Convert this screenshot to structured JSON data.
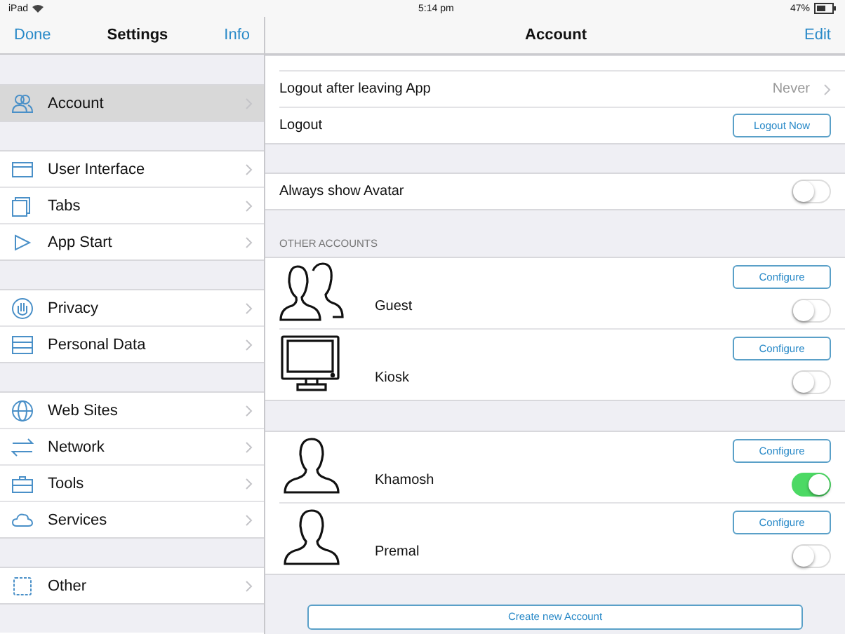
{
  "status_bar": {
    "device": "iPad",
    "time": "5:14 pm",
    "battery": "47%"
  },
  "sidebar": {
    "title": "Settings",
    "left_button": "Done",
    "right_button": "Info",
    "groups": [
      [
        {
          "label": "Account",
          "kind": "people",
          "selected": true
        }
      ],
      [
        {
          "label": "User Interface",
          "kind": "window",
          "selected": false
        },
        {
          "label": "Tabs",
          "kind": "tabs",
          "selected": false
        },
        {
          "label": "App Start",
          "kind": "play",
          "selected": false
        }
      ],
      [
        {
          "label": "Privacy",
          "kind": "hand",
          "selected": false
        },
        {
          "label": "Personal Data",
          "kind": "drawer",
          "selected": false
        }
      ],
      [
        {
          "label": "Web Sites",
          "kind": "globe",
          "selected": false
        },
        {
          "label": "Network",
          "kind": "arrows",
          "selected": false
        },
        {
          "label": "Tools",
          "kind": "briefcase",
          "selected": false
        },
        {
          "label": "Services",
          "kind": "cloud",
          "selected": false
        }
      ],
      [
        {
          "label": "Other",
          "kind": "chip",
          "selected": false
        }
      ]
    ]
  },
  "detail": {
    "title": "Account",
    "right_button": "Edit",
    "settings": [
      {
        "label": "Logout after leaving App",
        "kind": "value",
        "value": "Never"
      },
      {
        "label": "Logout",
        "kind": "button",
        "button": "Logout Now"
      }
    ],
    "avatar_setting": {
      "label": "Always show Avatar",
      "on": false
    },
    "section_header": "OTHER ACCOUNTS",
    "account_groups": [
      [
        {
          "name": "Guest",
          "kind": "group",
          "button": "Configure",
          "on": false
        },
        {
          "name": "Kiosk",
          "kind": "monitor",
          "button": "Configure",
          "on": false
        }
      ],
      [
        {
          "name": "Khamosh",
          "kind": "person",
          "button": "Configure",
          "on": true
        },
        {
          "name": "Premal",
          "kind": "person",
          "button": "Configure",
          "on": false
        }
      ]
    ],
    "create_button": "Create new Account"
  }
}
